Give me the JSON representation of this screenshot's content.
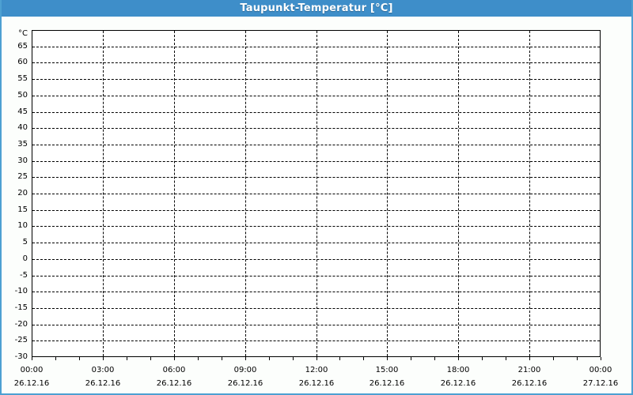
{
  "window": {
    "title": "Taupunkt-Temperatur [°C]"
  },
  "colors": {
    "titlebar_bg": "#3e8ec9",
    "titlebar_text": "#ffffff",
    "frame_border": "#4da0d2",
    "window_bg": "#fcfefc",
    "plot_bg": "#ffffff",
    "grid": "#000000",
    "axis": "#000000",
    "label_text": "#000000"
  },
  "chart_data": {
    "type": "line",
    "title": "Taupunkt-Temperatur [°C]",
    "xlabel": "",
    "ylabel": "°C",
    "ylim": [
      -30,
      70
    ],
    "ytick_step": 5,
    "ytick_labels": [
      "65",
      "60",
      "55",
      "50",
      "45",
      "40",
      "35",
      "30",
      "25",
      "20",
      "15",
      "10",
      "5",
      "0",
      "-5",
      "-10",
      "-15",
      "-20",
      "-25",
      "-30"
    ],
    "x_range_hours": 24,
    "x_major_step_hours": 3,
    "x_minor_step_hours": 1,
    "x_major_ticks": [
      {
        "time": "00:00",
        "date": "26.12.16"
      },
      {
        "time": "03:00",
        "date": "26.12.16"
      },
      {
        "time": "06:00",
        "date": "26.12.16"
      },
      {
        "time": "09:00",
        "date": "26.12.16"
      },
      {
        "time": "12:00",
        "date": "26.12.16"
      },
      {
        "time": "15:00",
        "date": "26.12.16"
      },
      {
        "time": "18:00",
        "date": "26.12.16"
      },
      {
        "time": "21:00",
        "date": "26.12.16"
      },
      {
        "time": "00:00",
        "date": "27.12.16"
      }
    ],
    "grid": "dashed",
    "legend": null,
    "series": []
  }
}
